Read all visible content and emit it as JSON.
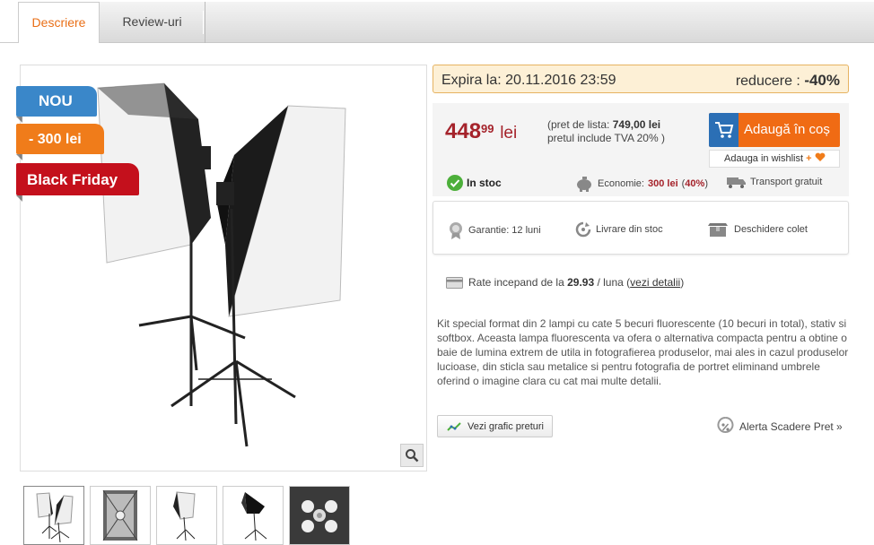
{
  "tabs": {
    "descriere": "Descriere",
    "reviews": "Review-uri"
  },
  "badges": {
    "nou": "NOU",
    "lei": "- 300 lei",
    "black_friday": "Black Friday"
  },
  "expiry": {
    "label": "Expira la: 20.11.2016 23:59",
    "discount_label": "reducere :",
    "discount_value": "-40%"
  },
  "price": {
    "integer": "448",
    "decimals": "99",
    "currency": "lei",
    "list_prefix": "(pret de lista:",
    "list_value": "749,00 lei",
    "vat": "pretul include TVA 20% )"
  },
  "cart": {
    "button": "Adaugă în coș",
    "wishlist": "Adauga in wishlist",
    "wishlist_plus": "+"
  },
  "status": {
    "stock": "In stoc",
    "economy_label": "Economie:",
    "economy_value": "300 lei",
    "economy_pct_open": "(",
    "economy_pct": "40%",
    "economy_pct_close": ")",
    "transport": "Transport gratuit"
  },
  "services": {
    "warranty": "Garantie: 12 luni",
    "delivery": "Livrare din stoc",
    "open_package": "Deschidere colet"
  },
  "rate": {
    "prefix": "Rate incepand de la",
    "amount": "29.93",
    "per": "/ luna (",
    "link": "vezi detalii",
    "close": ")"
  },
  "description": "Kit special format din 2 lampi cu cate 5 becuri fluorescente (10 becuri in total), stativ si softbox. Aceasta lampa fluorescenta va ofera o alternativa compacta pentru a obtine o baie de lumina extrem de utila in fotografierea produselor, mai ales in cazul produselor lucioase, din sticla sau metalice si pentru fotografia de portret eliminand umbrele oferind o imagine clara cu cat mai multe detalii.",
  "actions": {
    "graph": "Vezi grafic preturi",
    "alert": "Alerta Scadere Pret »"
  },
  "colors": {
    "accent_orange": "#f06b14",
    "price_red": "#a5232b",
    "cart_blue": "#2b6fb5",
    "badge_blue": "#3a87c9",
    "badge_red": "#c4101c"
  },
  "icons": [
    "search-icon",
    "cart-icon",
    "heart-icon",
    "check-icon",
    "piggy-bank-icon",
    "truck-icon",
    "warranty-icon",
    "delivery-icon",
    "package-icon",
    "card-icon",
    "chart-icon",
    "percent-icon"
  ]
}
